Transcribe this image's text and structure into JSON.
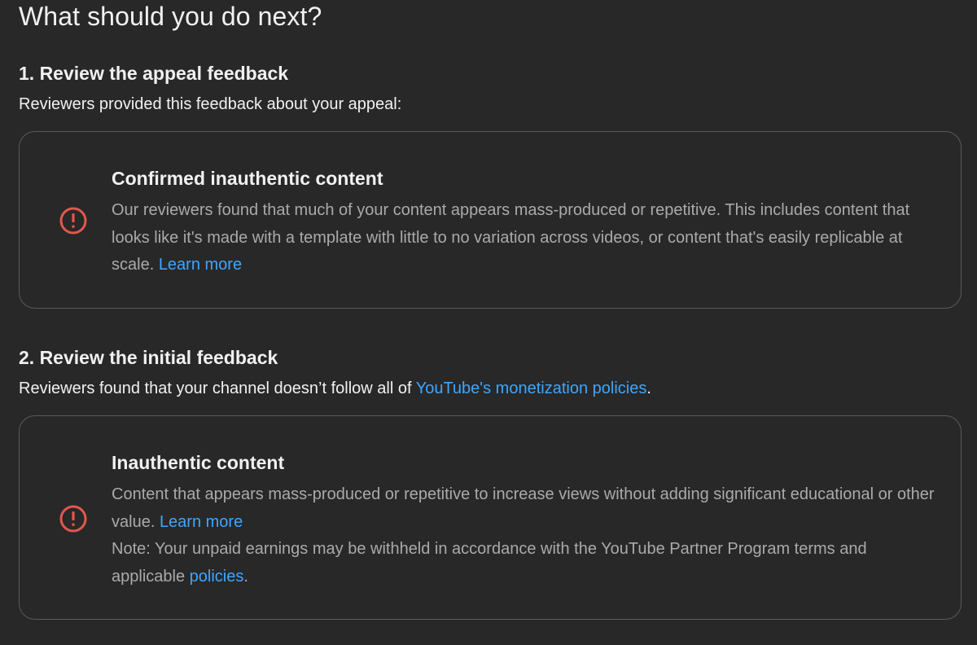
{
  "page_title": "What should you do next?",
  "section1": {
    "heading": "1. Review the appeal feedback",
    "description": "Reviewers provided this feedback about your appeal:",
    "card": {
      "icon": "alert-circle-icon",
      "title": "Confirmed inauthentic content",
      "text": "Our reviewers found that much of your content appears mass-produced or repetitive. This includes content that looks like it's made with a template with little to no variation across videos, or content that's easily replicable at scale.",
      "link_label": "Learn more"
    }
  },
  "section2": {
    "heading": "2. Review the initial feedback",
    "description_prefix": "Reviewers found that your channel doesn’t follow all of",
    "description_link": "YouTube's monetization policies",
    "description_suffix": ".",
    "card": {
      "icon": "alert-circle-icon",
      "title": "Inauthentic content",
      "text": "Content that appears mass-produced or repetitive to increase views without adding significant educational or other value.",
      "link_label": "Learn more",
      "note_text": "Note: Your unpaid earnings may be withheld in accordance with the YouTube Partner Program terms and applicable",
      "note_link": "policies",
      "note_suffix": "."
    }
  },
  "colors": {
    "background": "#282828",
    "text_primary": "#f1f1f1",
    "text_secondary": "#aaaaaa",
    "link": "#3ea6ff",
    "alert": "#e0584e",
    "card_border": "#5a5a5a"
  }
}
